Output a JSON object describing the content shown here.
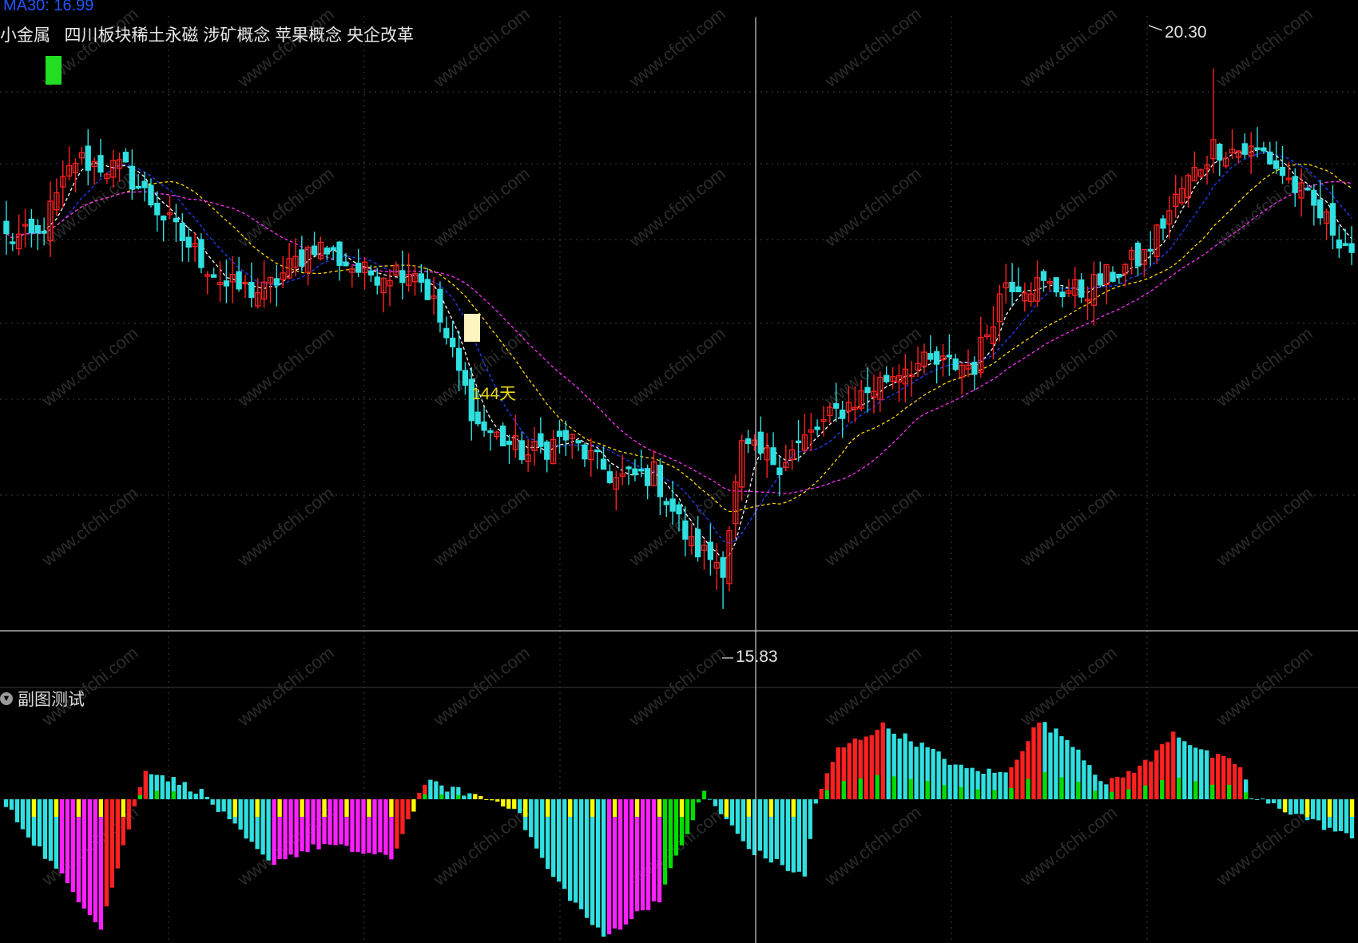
{
  "header": {
    "ma_label": "MA30: 16.99",
    "stock_tags": "小金属   四川板块稀土永磁 涉矿概念 苹果概念 央企改革"
  },
  "subchart": {
    "title": "副图测试"
  },
  "annotations": {
    "high_label": "20.30",
    "low_label": "15.83",
    "days_label": "144天"
  },
  "watermark": "www.cfchi.com",
  "colors": {
    "up": "#ff2020",
    "down": "#30e0e0",
    "ma5": "#ffffff",
    "ma10": "#2040ff",
    "ma20": "#ffd700",
    "ma30": "#ff30ff",
    "osc_magenta": "#ff20ff",
    "osc_yellow": "#ffff00",
    "osc_green": "#00dd00",
    "grid": "#404040"
  },
  "chart_data": [
    {
      "type": "candlestick",
      "title": "",
      "price_high": 20.3,
      "price_low": 15.83,
      "ylim": [
        15.65,
        20.6
      ],
      "moving_averages": [
        "MA5",
        "MA10",
        "MA20",
        "MA30"
      ],
      "grid": true,
      "segments": [
        {
          "bars": 6,
          "to": 18.9
        },
        {
          "bars": 6,
          "to": 19.55
        },
        {
          "bars": 8,
          "to": 19.45
        },
        {
          "bars": 8,
          "to": 18.95
        },
        {
          "bars": 8,
          "to": 18.5
        },
        {
          "bars": 6,
          "to": 18.45
        },
        {
          "bars": 8,
          "to": 18.85
        },
        {
          "bars": 8,
          "to": 18.6
        },
        {
          "bars": 8,
          "to": 18.65
        },
        {
          "bars": 3,
          "to": 18.35
        },
        {
          "bars": 7,
          "to": 17.35
        },
        {
          "bars": 8,
          "to": 17.1
        },
        {
          "bars": 6,
          "to": 17.25
        },
        {
          "bars": 8,
          "to": 16.9
        },
        {
          "bars": 6,
          "to": 16.95
        },
        {
          "bars": 6,
          "to": 16.35
        },
        {
          "bars": 5,
          "to": 16.2
        },
        {
          "bars": 3,
          "to": 17.15
        },
        {
          "bars": 6,
          "to": 17.05
        },
        {
          "bars": 9,
          "to": 17.45
        },
        {
          "bars": 11,
          "to": 17.85
        },
        {
          "bars": 11,
          "to": 17.85
        },
        {
          "bars": 5,
          "to": 18.55
        },
        {
          "bars": 12,
          "to": 18.45
        },
        {
          "bars": 10,
          "to": 18.75
        },
        {
          "bars": 6,
          "to": 19.3
        },
        {
          "bars": 5,
          "to": 19.65
        },
        {
          "bars": 8,
          "to": 19.6
        },
        {
          "bars": 7,
          "to": 19.2
        },
        {
          "bars": 7,
          "to": 18.8
        }
      ]
    },
    {
      "type": "bar",
      "title": "副图测试",
      "ylim": [
        -1.0,
        0.55
      ],
      "segments": [
        {
          "bars": 10,
          "to": -0.5,
          "color": "cyan"
        },
        {
          "bars": 8,
          "to": -0.9,
          "color": "magenta"
        },
        {
          "bars": 8,
          "to": 0.22,
          "color": "red"
        },
        {
          "bars": 10,
          "to": 0.05,
          "color": "cyan"
        },
        {
          "bars": 12,
          "to": -0.45,
          "color": "cyan"
        },
        {
          "bars": 10,
          "to": -0.32,
          "color": "magenta"
        },
        {
          "bars": 12,
          "to": -0.42,
          "color": "magenta"
        },
        {
          "bars": 6,
          "to": 0.12,
          "color": "red"
        },
        {
          "bars": 8,
          "to": 0.04,
          "color": "cyan"
        },
        {
          "bars": 8,
          "to": -0.05,
          "color": "yellow"
        },
        {
          "bars": 6,
          "to": -0.5,
          "color": "cyan"
        },
        {
          "bars": 10,
          "to": -0.98,
          "color": "cyan"
        },
        {
          "bars": 10,
          "to": -0.7,
          "color": "magenta"
        },
        {
          "bars": 8,
          "to": 0.05,
          "color": "green"
        },
        {
          "bars": 8,
          "to": -0.35,
          "color": "cyan"
        },
        {
          "bars": 10,
          "to": -0.55,
          "color": "cyan"
        },
        {
          "bars": 2,
          "to": -0.02,
          "color": "cyan"
        },
        {
          "bars": 4,
          "to": 0.35,
          "color": "red"
        },
        {
          "bars": 8,
          "to": 0.52,
          "color": "red"
        },
        {
          "bars": 8,
          "to": 0.36,
          "color": "cyan"
        },
        {
          "bars": 6,
          "to": 0.22,
          "color": "cyan"
        },
        {
          "bars": 8,
          "to": 0.18,
          "color": "cyan"
        },
        {
          "bars": 6,
          "to": 0.55,
          "color": "red"
        },
        {
          "bars": 6,
          "to": 0.4,
          "color": "cyan"
        },
        {
          "bars": 6,
          "to": 0.1,
          "color": "cyan"
        },
        {
          "bars": 8,
          "to": 0.28,
          "color": "red"
        },
        {
          "bars": 4,
          "to": 0.48,
          "color": "red"
        },
        {
          "bars": 6,
          "to": 0.32,
          "color": "cyan"
        },
        {
          "bars": 6,
          "to": 0.24,
          "color": "red"
        },
        {
          "bars": 2,
          "to": 0.01,
          "color": "cyan"
        },
        {
          "bars": 8,
          "to": -0.1,
          "color": "cyan"
        },
        {
          "bars": 10,
          "to": -0.28,
          "color": "cyan"
        }
      ]
    }
  ]
}
